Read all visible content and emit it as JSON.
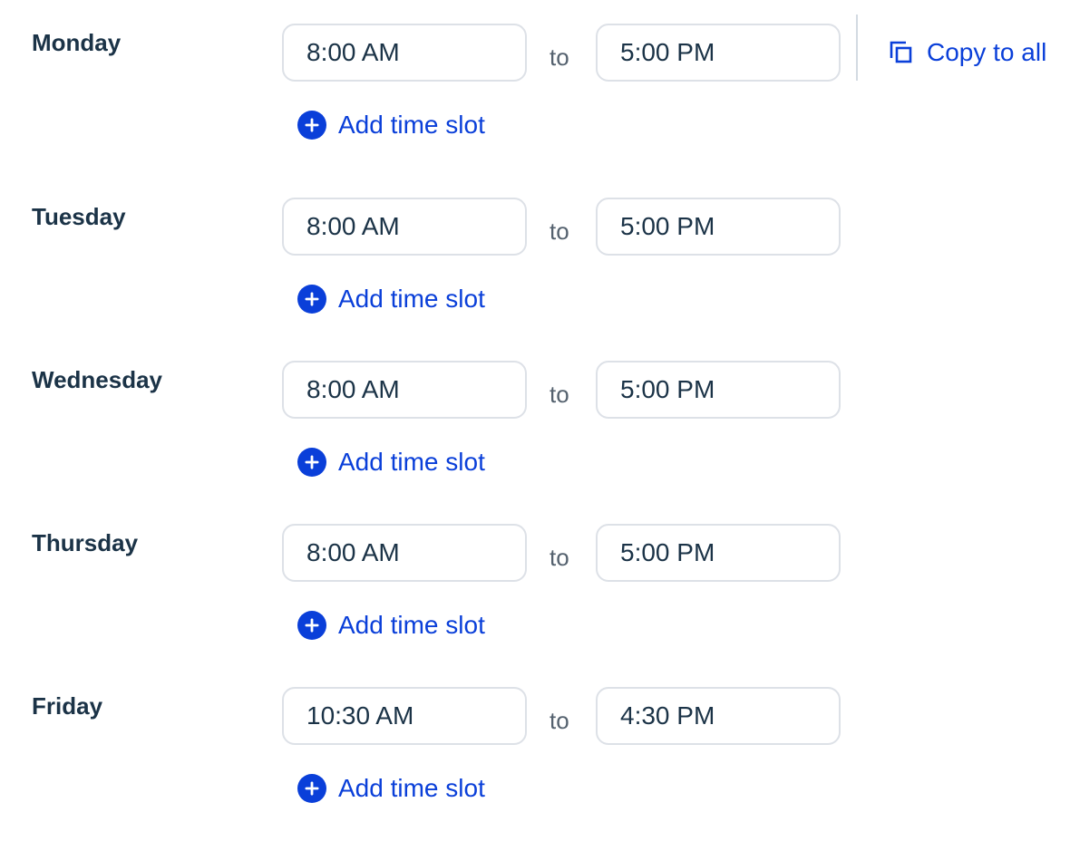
{
  "copy_to_all": {
    "label": "Copy to all",
    "icon": "copy-icon"
  },
  "separator": "to",
  "add_slot_label": "Add time slot",
  "days": [
    {
      "name": "Monday",
      "start": "8:00 AM",
      "end": "5:00 PM"
    },
    {
      "name": "Tuesday",
      "start": "8:00 AM",
      "end": "5:00 PM"
    },
    {
      "name": "Wednesday",
      "start": "8:00 AM",
      "end": "5:00 PM"
    },
    {
      "name": "Thursday",
      "start": "8:00 AM",
      "end": "5:00 PM"
    },
    {
      "name": "Friday",
      "start": "10:30 AM",
      "end": "4:30 PM"
    }
  ],
  "colors": {
    "accent": "#0a3fd9",
    "text": "#1b3347",
    "muted": "#54616e",
    "border": "#dde1e7"
  }
}
